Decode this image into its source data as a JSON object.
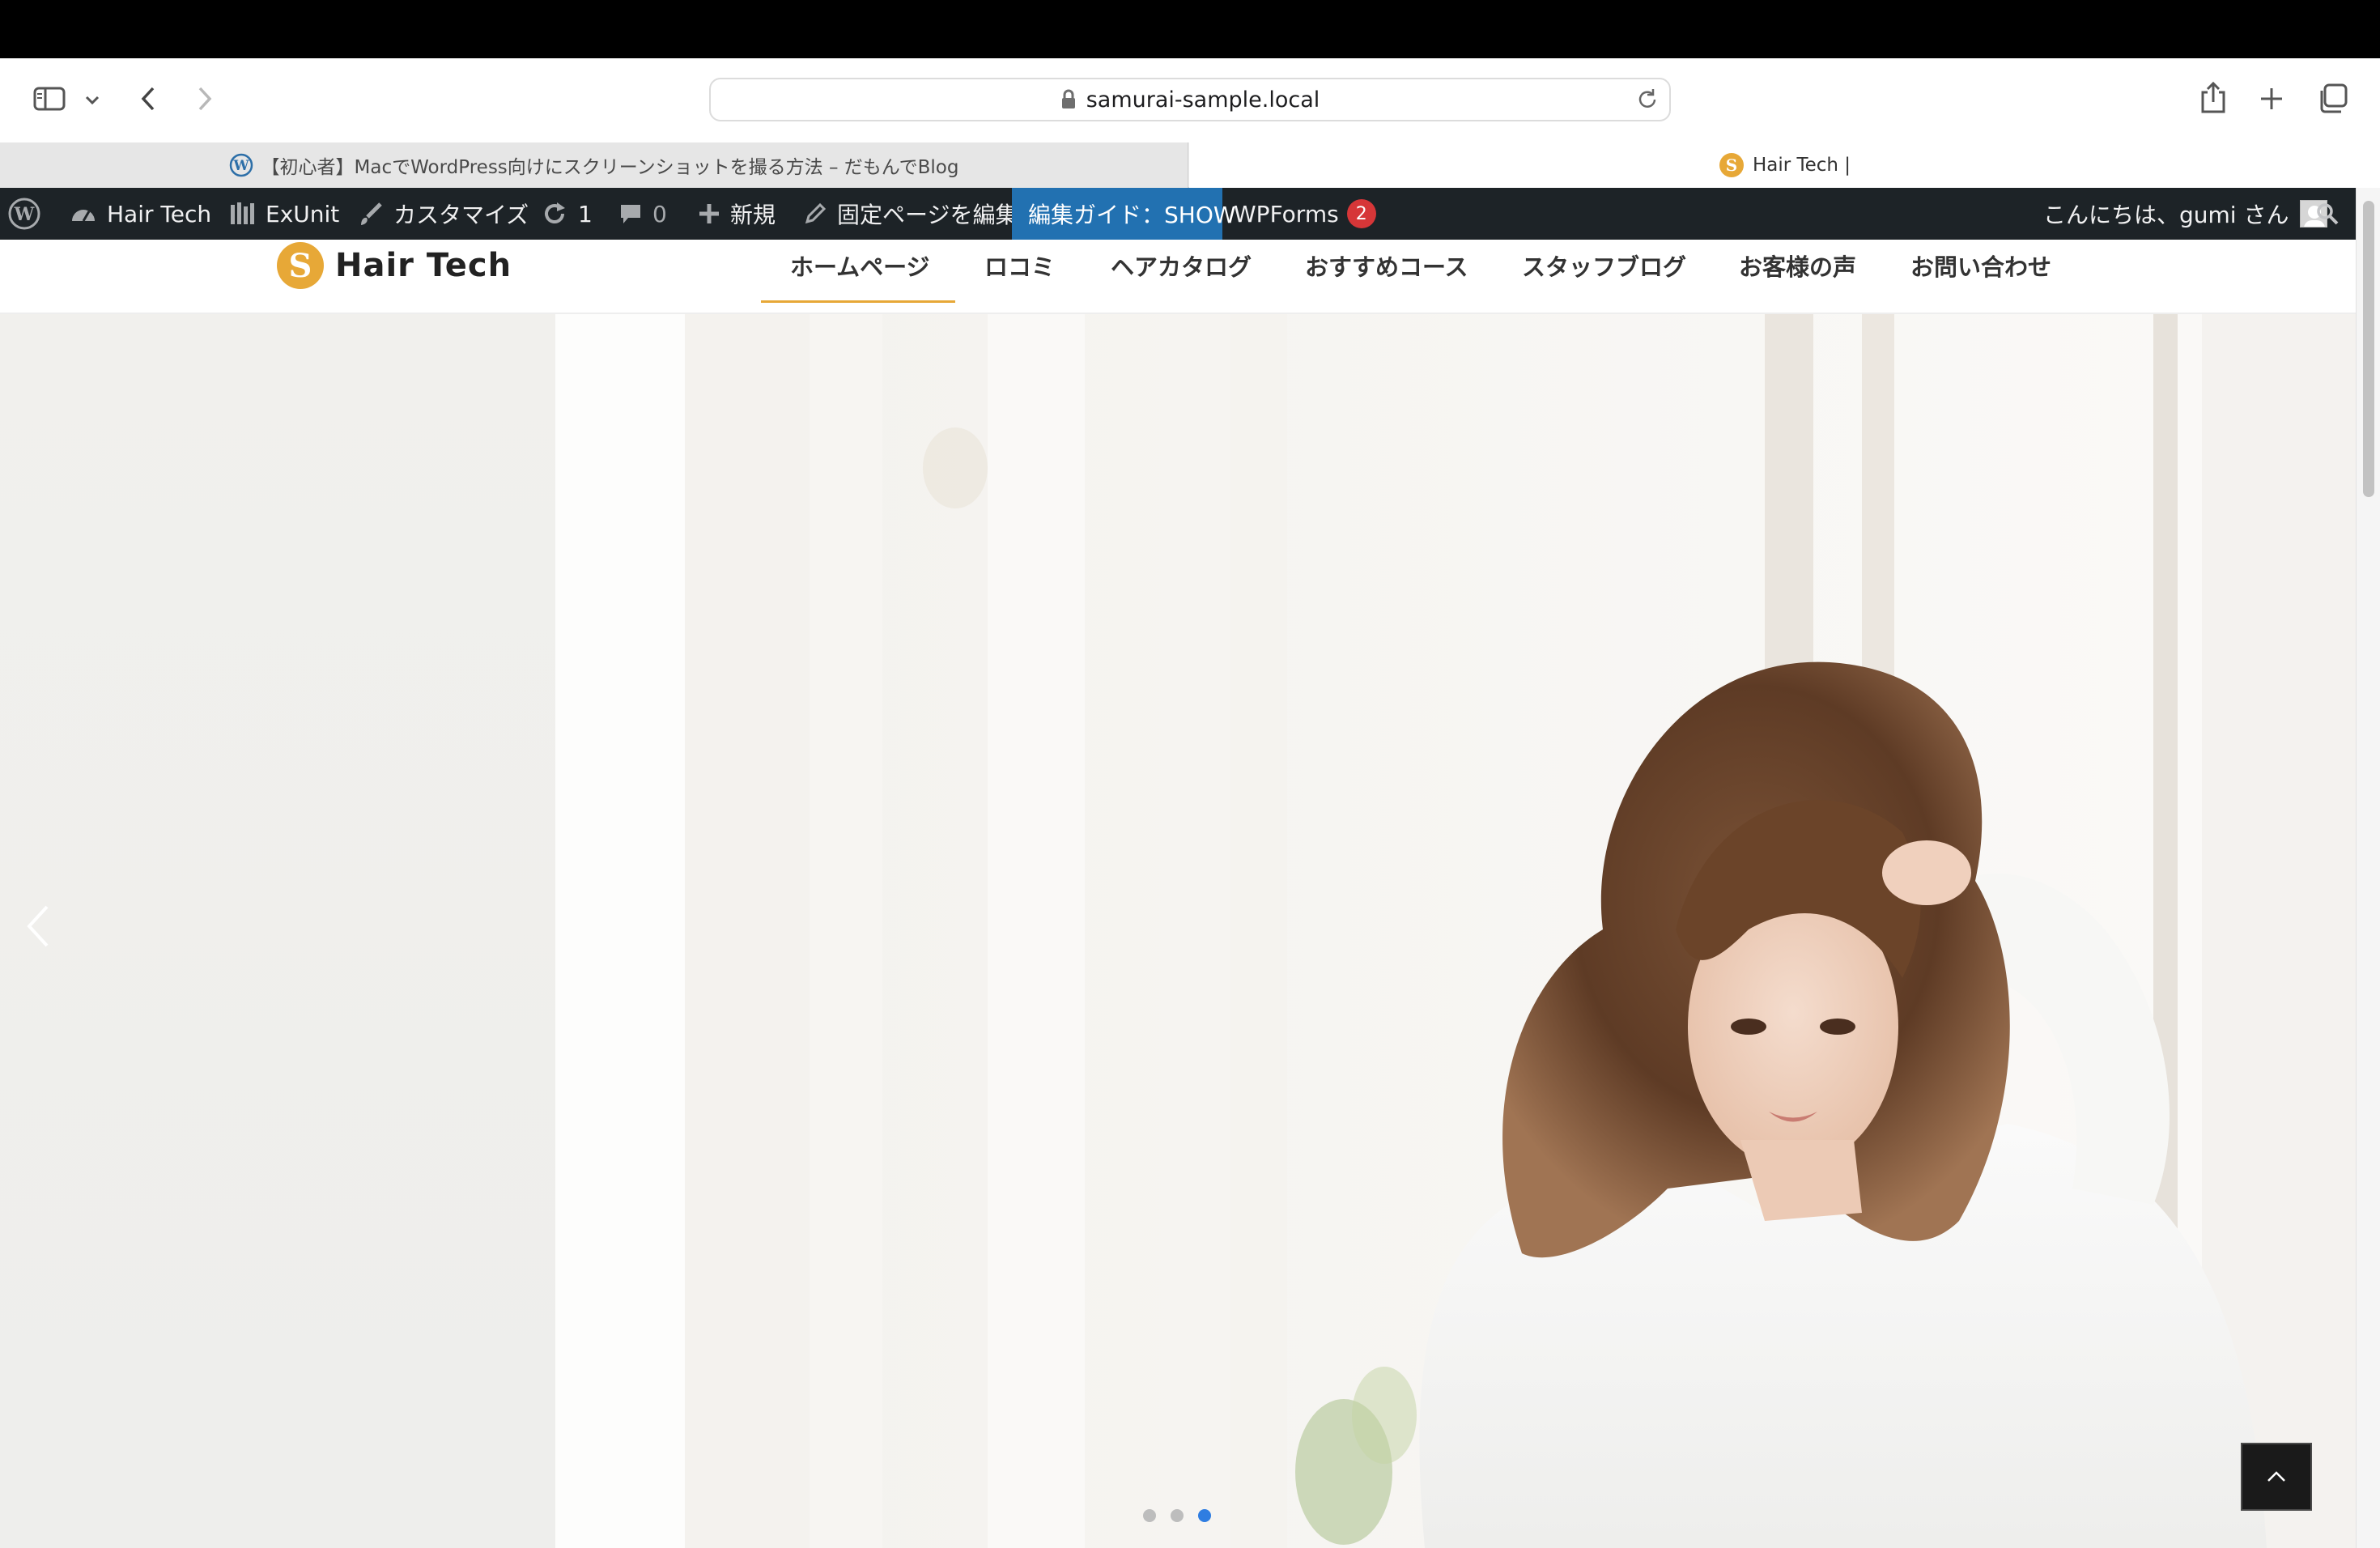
{
  "browser": {
    "url": "samurai-sample.local",
    "tabs": [
      {
        "title": "【初心者】MacでWordPress向けにスクリーンショットを撮る方法 – だもんでBlog",
        "active": false
      },
      {
        "title": "Hair Tech |",
        "active": true
      }
    ]
  },
  "adminbar": {
    "site_name": "Hair Tech",
    "exunit": "ExUnit",
    "customize": "カスタマイズ",
    "updates": "1",
    "comments": "0",
    "new": "新規",
    "edit_page": "固定ページを編集",
    "guide": "編集ガイド：SHOW",
    "wpforms": "WPForms",
    "wpforms_count": "2",
    "greeting": "こんにちは、gumi さん"
  },
  "site": {
    "logo_text": "Hair Tech",
    "logo_mark": "S",
    "accent": "#e7a837",
    "nav": [
      "ホームページ",
      "ロコミ",
      "ヘアカタログ",
      "おすすめコース",
      "スタッフブログ",
      "お客様の声",
      "お問い合わせ"
    ],
    "active_nav": "ホームページ"
  },
  "slider": {
    "slides": 3,
    "active_slide": 3
  }
}
